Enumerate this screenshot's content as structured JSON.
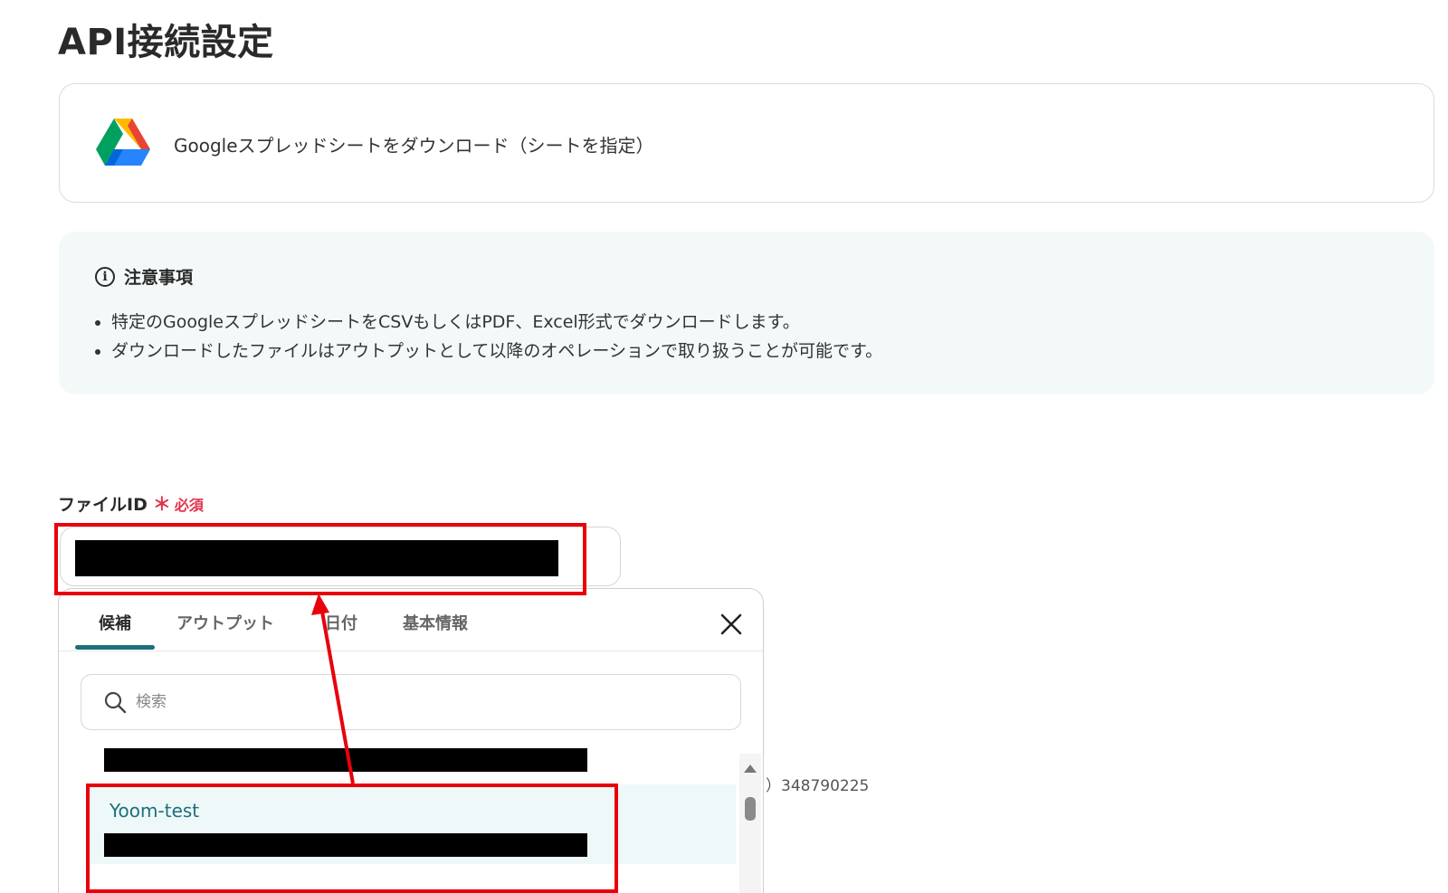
{
  "page": {
    "title": "API接続設定"
  },
  "action": {
    "name": "Googleスプレッドシートをダウンロード（シートを指定）",
    "icon": "google-drive-icon"
  },
  "notice": {
    "heading": "注意事項",
    "items": [
      "特定のGoogleスプレッドシートをCSVもしくはPDF、Excel形式でダウンロードします。",
      "ダウンロードしたファイルはアウトプットとして以降のオペレーションで取り扱うことが可能です。"
    ]
  },
  "file_field": {
    "label": "ファイルID",
    "required_mark": "＊",
    "required_text": "必須",
    "value_redacted": true
  },
  "popover": {
    "tabs": [
      {
        "label": "候補",
        "active": true
      },
      {
        "label": "アウトプット",
        "active": false
      },
      {
        "label": "日付",
        "active": false
      },
      {
        "label": "基本情報",
        "active": false
      }
    ],
    "search": {
      "placeholder": "検索"
    },
    "selected_item": {
      "title": "Yoom-test"
    }
  },
  "background_peek_text": "）348790225",
  "colors": {
    "accent": "#1c6f7c",
    "required": "#e0334a",
    "annotation": "#e8000b",
    "notice_bg": "#f3f9f9"
  }
}
